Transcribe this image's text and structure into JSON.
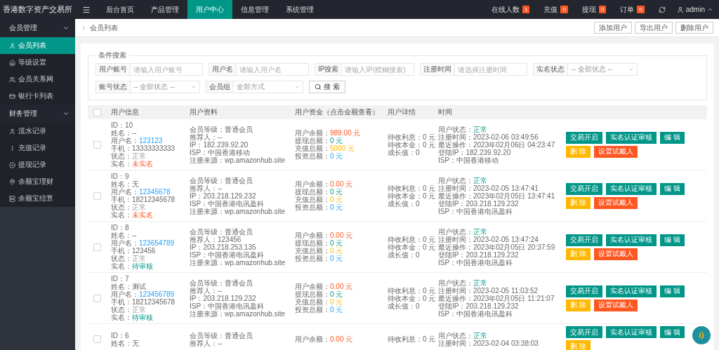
{
  "logo": "香港数字资产交易所",
  "top_nav": [
    {
      "label": "后台首页",
      "selected": false
    },
    {
      "label": "产品管理",
      "selected": false
    },
    {
      "label": "用户中心",
      "selected": true
    },
    {
      "label": "信息管理",
      "selected": false
    },
    {
      "label": "系统管理",
      "selected": false
    }
  ],
  "top_stats": [
    {
      "label": "在线人数",
      "count": "1"
    },
    {
      "label": "充值",
      "count": "0"
    },
    {
      "label": "提现",
      "count": "0"
    },
    {
      "label": "订单",
      "count": "0"
    }
  ],
  "user": {
    "name": "admin"
  },
  "sidebar": [
    {
      "label": "会员管理",
      "expanded": true,
      "children": [
        {
          "label": "会员列表",
          "selected": true
        },
        {
          "label": "等级设置",
          "selected": false
        },
        {
          "label": "会员关系网",
          "selected": false
        },
        {
          "label": "银行卡列表",
          "selected": false
        }
      ]
    },
    {
      "label": "财务管理",
      "expanded": true,
      "children": [
        {
          "label": "流水记录",
          "selected": false
        },
        {
          "label": "充值记录",
          "selected": false
        },
        {
          "label": "提现记录",
          "selected": false
        },
        {
          "label": "余额宝理财",
          "selected": false
        },
        {
          "label": "余额宝结算",
          "selected": false
        }
      ]
    }
  ],
  "breadcrumb": "会员列表",
  "header_buttons": [
    "添加用户",
    "导出用户",
    "删除用户"
  ],
  "search": {
    "title": "条件搜索",
    "fields": [
      {
        "kind": "input",
        "label": "用户账号",
        "placeholder": "请输入用户账号"
      },
      {
        "kind": "input",
        "label": "用户名",
        "placeholder": "请输入用户名"
      },
      {
        "kind": "input",
        "label": "IP搜索",
        "placeholder": "请输入IP(模糊搜索)"
      },
      {
        "kind": "input",
        "label": "注册时间",
        "placeholder": "请选择注册时间"
      },
      {
        "kind": "select",
        "label": "实名状态",
        "placeholder": "-- 全部状态 --"
      },
      {
        "kind": "select",
        "label": "账号状态",
        "placeholder": "-- 全部状态 --"
      },
      {
        "kind": "select",
        "label": "会员组",
        "placeholder": "全部方式"
      }
    ],
    "button": "搜 索"
  },
  "table": {
    "select_all": {
      "checked": false
    },
    "columns": [
      "用户信息",
      "用户资料",
      "用户资金（点击金额查看）",
      "用户详情",
      "时间"
    ],
    "rows": [
      {
        "checked": false,
        "info": [
          {
            "label": "ID：",
            "value": "10",
            "kind": "plain"
          },
          {
            "label": "姓名：",
            "value": "--",
            "kind": "plain"
          },
          {
            "label": "用户名：",
            "value": "123123",
            "kind": "link"
          },
          {
            "label": "手机：",
            "value": "13333333333",
            "kind": "plain"
          },
          {
            "label": "状态：",
            "value": "正常",
            "kind": "muted"
          },
          {
            "label": "实名：",
            "value": "未实名",
            "kind": "danger"
          }
        ],
        "profile": [
          {
            "label": "会员等级：",
            "value": "普通会员",
            "kind": "plain"
          },
          {
            "label": "推荐人：",
            "value": "--",
            "kind": "plain"
          },
          {
            "label": "IP：",
            "value": "182.239.92.20",
            "kind": "plain"
          },
          {
            "label": "ISP：",
            "value": "中国香港移动",
            "kind": "plain"
          },
          {
            "label": "注册来源：",
            "value": "wp.amazonhub.site",
            "kind": "plain"
          }
        ],
        "funds": [
          {
            "label": "用户余额：",
            "value": "989.00 元",
            "kind": "danger"
          },
          {
            "label": "提现总额：",
            "value": "0 元",
            "kind": "success"
          },
          {
            "label": "充值总额：",
            "value": "5000 元",
            "kind": "warning"
          },
          {
            "label": "投资总额：",
            "value": "0 元",
            "kind": "info"
          }
        ],
        "details": [
          {
            "label": "待收利息：",
            "value": "0 元",
            "kind": "plain"
          },
          {
            "label": "待收本金：",
            "value": "0 元",
            "kind": "plain"
          },
          {
            "label": "成长值：",
            "value": "0",
            "kind": "plain"
          }
        ],
        "time": [
          {
            "label": "用户状态：",
            "value": "正常",
            "kind": "success"
          },
          {
            "label": "注册时间：",
            "value": "2023-02-06 03:49:56",
            "kind": "plain"
          },
          {
            "label": "最近操作：",
            "value": "2023年02月06日 04:23:47",
            "kind": "plain"
          },
          {
            "label": "登陆IP：",
            "value": "182.239.92.20",
            "kind": "plain"
          },
          {
            "label": "ISP：",
            "value": "中国香港移动",
            "kind": "plain"
          }
        ],
        "actions": [
          {
            "label": "交易开启",
            "kind": "primary"
          },
          {
            "label": "实名认证审核",
            "kind": "primary"
          },
          {
            "label": "编 辑",
            "kind": "primary"
          },
          {
            "label": "删 除",
            "kind": "warm"
          },
          {
            "label": "设置试戴人",
            "kind": "danger"
          }
        ]
      },
      {
        "checked": false,
        "info": [
          {
            "label": "ID：",
            "value": "9",
            "kind": "plain"
          },
          {
            "label": "姓名：",
            "value": "无",
            "kind": "plain"
          },
          {
            "label": "用户名：",
            "value": "12345678",
            "kind": "link"
          },
          {
            "label": "手机：",
            "value": "18212345678",
            "kind": "plain"
          },
          {
            "label": "状态：",
            "value": "正常",
            "kind": "muted"
          },
          {
            "label": "实名：",
            "value": "未实名",
            "kind": "danger"
          }
        ],
        "profile": [
          {
            "label": "会员等级：",
            "value": "普通会员",
            "kind": "plain"
          },
          {
            "label": "推荐人：",
            "value": "--",
            "kind": "plain"
          },
          {
            "label": "IP：",
            "value": "203.218.129.232",
            "kind": "plain"
          },
          {
            "label": "ISP：",
            "value": "中国香港电讯盈科",
            "kind": "plain"
          },
          {
            "label": "注册来源：",
            "value": "wp.amazonhub.site",
            "kind": "plain"
          }
        ],
        "funds": [
          {
            "label": "用户余额：",
            "value": "0.00 元",
            "kind": "danger"
          },
          {
            "label": "提现总额：",
            "value": "0 元",
            "kind": "success"
          },
          {
            "label": "充值总额：",
            "value": "0 元",
            "kind": "warning"
          },
          {
            "label": "投资总额：",
            "value": "0 元",
            "kind": "info"
          }
        ],
        "details": [
          {
            "label": "待收利息：",
            "value": "0 元",
            "kind": "plain"
          },
          {
            "label": "待收本金：",
            "value": "0 元",
            "kind": "plain"
          },
          {
            "label": "成长值：",
            "value": "0",
            "kind": "plain"
          }
        ],
        "time": [
          {
            "label": "用户状态：",
            "value": "正常",
            "kind": "success"
          },
          {
            "label": "注册时间：",
            "value": "2023-02-05 13:47:41",
            "kind": "plain"
          },
          {
            "label": "最近操作：",
            "value": "2023年02月05日 13:47:41",
            "kind": "plain"
          },
          {
            "label": "登陆IP：",
            "value": "203.218.129.232",
            "kind": "plain"
          },
          {
            "label": "ISP：",
            "value": "中国香港电讯盈科",
            "kind": "plain"
          }
        ],
        "actions": [
          {
            "label": "交易开启",
            "kind": "primary"
          },
          {
            "label": "实名认证审核",
            "kind": "primary"
          },
          {
            "label": "编 辑",
            "kind": "primary"
          },
          {
            "label": "删 除",
            "kind": "warm"
          },
          {
            "label": "设置试戴人",
            "kind": "danger"
          }
        ]
      },
      {
        "checked": false,
        "info": [
          {
            "label": "ID：",
            "value": "8",
            "kind": "plain"
          },
          {
            "label": "姓名：",
            "value": "--",
            "kind": "plain"
          },
          {
            "label": "用户名：",
            "value": "123654789",
            "kind": "link"
          },
          {
            "label": "手机：",
            "value": "123456",
            "kind": "plain"
          },
          {
            "label": "状态：",
            "value": "正常",
            "kind": "muted"
          },
          {
            "label": "实名：",
            "value": "待审核",
            "kind": "success"
          }
        ],
        "profile": [
          {
            "label": "会员等级：",
            "value": "普通会员",
            "kind": "plain"
          },
          {
            "label": "推荐人：",
            "value": "123456",
            "kind": "plain"
          },
          {
            "label": "IP：",
            "value": "203.218.253.135",
            "kind": "plain"
          },
          {
            "label": "ISP：",
            "value": "中国香港电讯盈科",
            "kind": "plain"
          },
          {
            "label": "注册来源：",
            "value": "wp.amazonhub.site",
            "kind": "plain"
          }
        ],
        "funds": [
          {
            "label": "用户余额：",
            "value": "0.00 元",
            "kind": "danger"
          },
          {
            "label": "提现总额：",
            "value": "0 元",
            "kind": "success"
          },
          {
            "label": "充值总额：",
            "value": "0 元",
            "kind": "warning"
          },
          {
            "label": "投资总额：",
            "value": "0 元",
            "kind": "info"
          }
        ],
        "details": [
          {
            "label": "待收利息：",
            "value": "0 元",
            "kind": "plain"
          },
          {
            "label": "待收本金：",
            "value": "0 元",
            "kind": "plain"
          },
          {
            "label": "成长值：",
            "value": "0",
            "kind": "plain"
          }
        ],
        "time": [
          {
            "label": "用户状态：",
            "value": "正常",
            "kind": "success"
          },
          {
            "label": "注册时间：",
            "value": "2023-02-05 13:47:24",
            "kind": "plain"
          },
          {
            "label": "最近操作：",
            "value": "2023年02月05日 20:37:59",
            "kind": "plain"
          },
          {
            "label": "登陆IP：",
            "value": "203.218.129.232",
            "kind": "plain"
          },
          {
            "label": "ISP：",
            "value": "中国香港电讯盈科",
            "kind": "plain"
          }
        ],
        "actions": [
          {
            "label": "交易开启",
            "kind": "primary"
          },
          {
            "label": "实名认证审核",
            "kind": "primary"
          },
          {
            "label": "编 辑",
            "kind": "primary"
          },
          {
            "label": "删 除",
            "kind": "warm"
          },
          {
            "label": "设置试戴人",
            "kind": "danger"
          }
        ]
      },
      {
        "checked": false,
        "info": [
          {
            "label": "ID：",
            "value": "7",
            "kind": "plain"
          },
          {
            "label": "姓名：",
            "value": "测试",
            "kind": "plain"
          },
          {
            "label": "用户名：",
            "value": "123456789",
            "kind": "link"
          },
          {
            "label": "手机：",
            "value": "18212345678",
            "kind": "plain"
          },
          {
            "label": "状态：",
            "value": "正常",
            "kind": "muted"
          },
          {
            "label": "实名：",
            "value": "待审核",
            "kind": "success"
          }
        ],
        "profile": [
          {
            "label": "会员等级：",
            "value": "普通会员",
            "kind": "plain"
          },
          {
            "label": "推荐人：",
            "value": "--",
            "kind": "plain"
          },
          {
            "label": "IP：",
            "value": "203.218.129.232",
            "kind": "plain"
          },
          {
            "label": "ISP：",
            "value": "中国香港电讯盈科",
            "kind": "plain"
          },
          {
            "label": "注册来源：",
            "value": "wp.amazonhub.site",
            "kind": "plain"
          }
        ],
        "funds": [
          {
            "label": "用户余额：",
            "value": "0.00 元",
            "kind": "danger"
          },
          {
            "label": "提现总额：",
            "value": "0 元",
            "kind": "success"
          },
          {
            "label": "充值总额：",
            "value": "0 元",
            "kind": "warning"
          },
          {
            "label": "投资总额：",
            "value": "0 元",
            "kind": "info"
          }
        ],
        "details": [
          {
            "label": "待收利息：",
            "value": "0 元",
            "kind": "plain"
          },
          {
            "label": "待收本金：",
            "value": "0 元",
            "kind": "plain"
          },
          {
            "label": "成长值：",
            "value": "0",
            "kind": "plain"
          }
        ],
        "time": [
          {
            "label": "用户状态：",
            "value": "正常",
            "kind": "success"
          },
          {
            "label": "注册时间：",
            "value": "2023-02-05 11:03:52",
            "kind": "plain"
          },
          {
            "label": "最近操作：",
            "value": "2023年02月05日 11:21:07",
            "kind": "plain"
          },
          {
            "label": "登陆IP：",
            "value": "203.218.129.232",
            "kind": "plain"
          },
          {
            "label": "ISP：",
            "value": "中国香港电讯盈科",
            "kind": "plain"
          }
        ],
        "actions": [
          {
            "label": "交易开启",
            "kind": "primary"
          },
          {
            "label": "实名认证审核",
            "kind": "primary"
          },
          {
            "label": "编 辑",
            "kind": "primary"
          },
          {
            "label": "删 除",
            "kind": "warm"
          },
          {
            "label": "设置试戴人",
            "kind": "danger"
          }
        ]
      },
      {
        "checked": false,
        "info": [
          {
            "label": "ID：",
            "value": "6",
            "kind": "plain"
          },
          {
            "label": "姓名：",
            "value": "无",
            "kind": "plain"
          }
        ],
        "profile": [
          {
            "label": "会员等级：",
            "value": "普通会员",
            "kind": "plain"
          },
          {
            "label": "推荐人：",
            "value": "--",
            "kind": "plain"
          }
        ],
        "funds": [
          {
            "label": "用户余额：",
            "value": "0.00 元",
            "kind": "danger"
          }
        ],
        "details": [
          {
            "label": "待收利息：",
            "value": "0 元",
            "kind": "plain"
          }
        ],
        "time": [
          {
            "label": "用户状态：",
            "value": "正常",
            "kind": "success"
          },
          {
            "label": "注册时间：",
            "value": "2023-02-04 03:38:03",
            "kind": "plain"
          }
        ],
        "actions": [
          {
            "label": "交易开启",
            "kind": "primary"
          },
          {
            "label": "实名认证审核",
            "kind": "primary"
          },
          {
            "label": "编 辑",
            "kind": "primary"
          },
          {
            "label": "删 除",
            "kind": "warm"
          }
        ]
      }
    ]
  }
}
